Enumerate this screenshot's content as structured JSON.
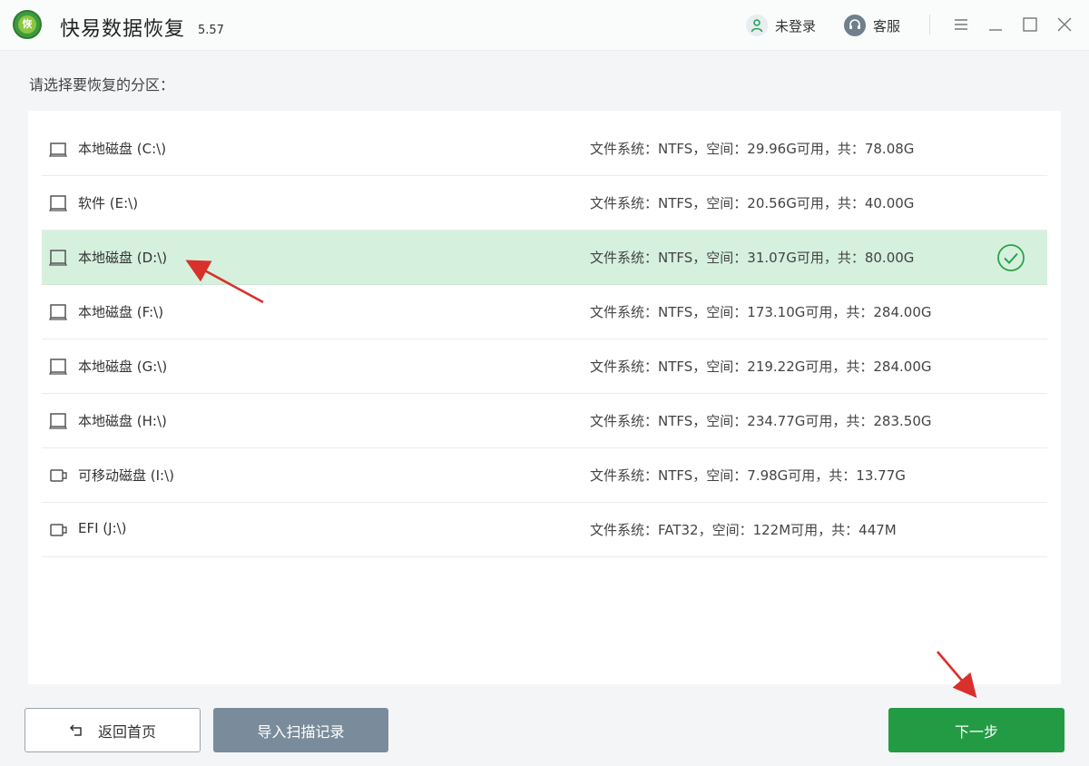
{
  "app": {
    "name": "快易数据恢复",
    "version": "5.57"
  },
  "header": {
    "login_label": "未登录",
    "service_label": "客服"
  },
  "prompt": "请选择要恢复的分区：",
  "partitions": [
    {
      "name": "本地磁盘 (C:\\)",
      "info": "文件系统：NTFS，空间：29.96G可用，共：78.08G",
      "icon": "local-disk-icon",
      "selected": false
    },
    {
      "name": "软件 (E:\\)",
      "info": "文件系统：NTFS，空间：20.56G可用，共：40.00G",
      "icon": "local-disk-icon",
      "selected": false
    },
    {
      "name": "本地磁盘 (D:\\)",
      "info": "文件系统：NTFS，空间：31.07G可用，共：80.00G",
      "icon": "local-disk-icon",
      "selected": true
    },
    {
      "name": "本地磁盘 (F:\\)",
      "info": "文件系统：NTFS，空间：173.10G可用，共：284.00G",
      "icon": "local-disk-icon",
      "selected": false
    },
    {
      "name": "本地磁盘 (G:\\)",
      "info": "文件系统：NTFS，空间：219.22G可用，共：284.00G",
      "icon": "local-disk-icon",
      "selected": false
    },
    {
      "name": "本地磁盘 (H:\\)",
      "info": "文件系统：NTFS，空间：234.77G可用，共：283.50G",
      "icon": "local-disk-icon",
      "selected": false
    },
    {
      "name": "可移动磁盘 (I:\\)",
      "info": "文件系统：NTFS，空间：7.98G可用，共：13.77G",
      "icon": "removable-disk-icon",
      "selected": false
    },
    {
      "name": "EFI (J:\\)",
      "info": "文件系统：FAT32，空间：122M可用，共：447M",
      "icon": "removable-disk-icon",
      "selected": false
    }
  ],
  "footer": {
    "back_label": "返回首页",
    "import_label": "导入扫描记录",
    "next_label": "下一步"
  },
  "colors": {
    "accent": "#239b45",
    "selected_row": "#d6f0de",
    "import_button": "#7a8c9b",
    "annotation_arrow": "#d9302c"
  }
}
